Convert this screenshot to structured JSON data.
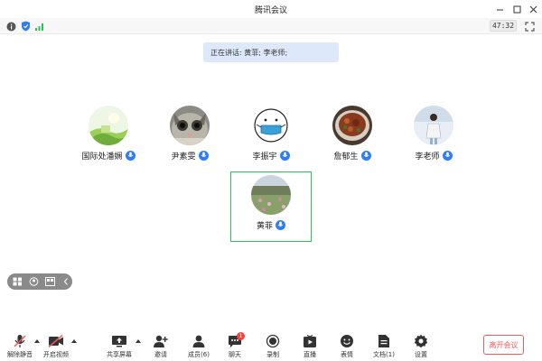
{
  "window": {
    "title": "腾讯会议"
  },
  "status": {
    "timer": "47:32",
    "icons": [
      "info-icon",
      "shield-icon",
      "signal-icon",
      "fullscreen-icon"
    ]
  },
  "banner": {
    "speaking_text": "正在讲话: 黄菲; 李老师;"
  },
  "participants": [
    {
      "name": "国际处潘娴",
      "mic": "mic-icon",
      "avatar": "landscape-green-avatar"
    },
    {
      "name": "尹素雯",
      "mic": "mic-icon",
      "avatar": "cat-avatar"
    },
    {
      "name": "李振宇",
      "mic": "mic-icon",
      "avatar": "cartoon-mask-avatar"
    },
    {
      "name": "詹郁生",
      "mic": "mic-icon",
      "avatar": "food-bowl-avatar"
    },
    {
      "name": "李老师",
      "mic": "mic-icon",
      "avatar": "person-photo-avatar"
    },
    {
      "name": "黄菲",
      "mic": "mic-icon",
      "avatar": "field-landscape-avatar",
      "active": true
    }
  ],
  "toolbar": {
    "unmute": "解除静音",
    "video": "开启视频",
    "share": "共享屏幕",
    "invite": "邀请",
    "members": "成员(6)",
    "chat": "聊天",
    "chat_badge": "1",
    "record": "录制",
    "live": "直播",
    "reactions": "表情",
    "docs": "文档(1)",
    "settings": "设置",
    "leave": "离开会议"
  },
  "colors": {
    "accent_blue": "#2f7cf6",
    "active_green": "#2fbf5b",
    "leave_red": "#f25b5b",
    "banner_bg": "#dde9fb"
  }
}
